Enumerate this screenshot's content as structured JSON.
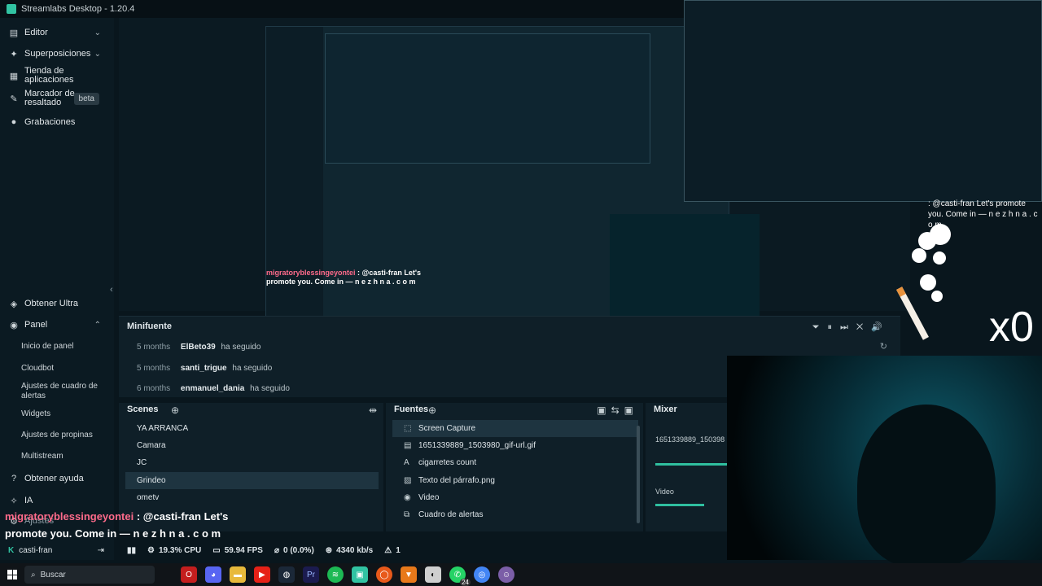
{
  "window": {
    "title": "Streamlabs Desktop - 1.20.4"
  },
  "sidebar": {
    "top_items": [
      {
        "label": "Editor",
        "has_chevron": true
      },
      {
        "label": "Superposiciones",
        "has_chevron": true
      },
      {
        "label": "Tienda de aplicaciones",
        "has_chevron": false
      },
      {
        "label": "Marcador de resaltado",
        "badge": "beta"
      },
      {
        "label": "Grabaciones"
      }
    ],
    "bottom_items": {
      "ultra": "Obtener Ultra",
      "panel": "Panel",
      "panel_subitems": [
        "Inicio de panel",
        "Cloudbot",
        "Ajustes de cuadro de alertas",
        "Widgets",
        "Ajustes de propinas",
        "Multistream"
      ],
      "help": "Obtener ayuda",
      "ia": "IA",
      "settings": "Ajustes",
      "user": "casti-fran"
    }
  },
  "minifuente": {
    "title": "Minifuente",
    "events": [
      {
        "time": "5 months",
        "user": "ElBeto39",
        "action": "ha seguido"
      },
      {
        "time": "5 months",
        "user": "santi_trigue",
        "action": "ha seguido"
      },
      {
        "time": "6 months",
        "user": "enmanuel_dania",
        "action": "ha seguido"
      }
    ]
  },
  "scenes": {
    "title": "Scenes",
    "items": [
      "YA ARRANCA",
      "Camara",
      "JC",
      "Grindeo",
      "ometv"
    ],
    "selected": "Grindeo"
  },
  "sources": {
    "title": "Fuentes",
    "items": [
      {
        "label": "Screen Capture",
        "icon": "screen-icon"
      },
      {
        "label": "1651339889_1503980_gif-url.gif",
        "icon": "file-icon"
      },
      {
        "label": "cigarretes count",
        "icon": "text-icon"
      },
      {
        "label": "Texto del párrafo.png",
        "icon": "image-icon"
      },
      {
        "label": "Video",
        "icon": "webcam-icon"
      },
      {
        "label": "Cuadro de alertas",
        "icon": "alert-box-icon"
      }
    ],
    "selected": "Screen Capture"
  },
  "mixer": {
    "title": "Mixer",
    "items": [
      {
        "label": "1651339889_150398"
      },
      {
        "label": "Video"
      }
    ]
  },
  "statusbar": {
    "cpu": "19.3% CPU",
    "fps": "59.94 FPS",
    "dropped": "0 (0.0%)",
    "bitrate": "4340 kb/s",
    "alerts": "1"
  },
  "chat_overlay": {
    "user": "migratoryblessingeyontei",
    "message_line1": ": @casti-fran Let's",
    "message_line2": "promote you. Come in — n e z h n a . c o m"
  },
  "overlay": {
    "counter": "x0",
    "chat_top": ": @casti-fran Let's promote you. Come in — n e z h n a . c o m"
  },
  "taskbar": {
    "search_placeholder": "Buscar",
    "whatsapp_badge": "24"
  },
  "colors": {
    "accent": "#31c3a2",
    "chat_user": "#ff6b8b",
    "background": "#09161d",
    "panel": "#0f1f28"
  }
}
